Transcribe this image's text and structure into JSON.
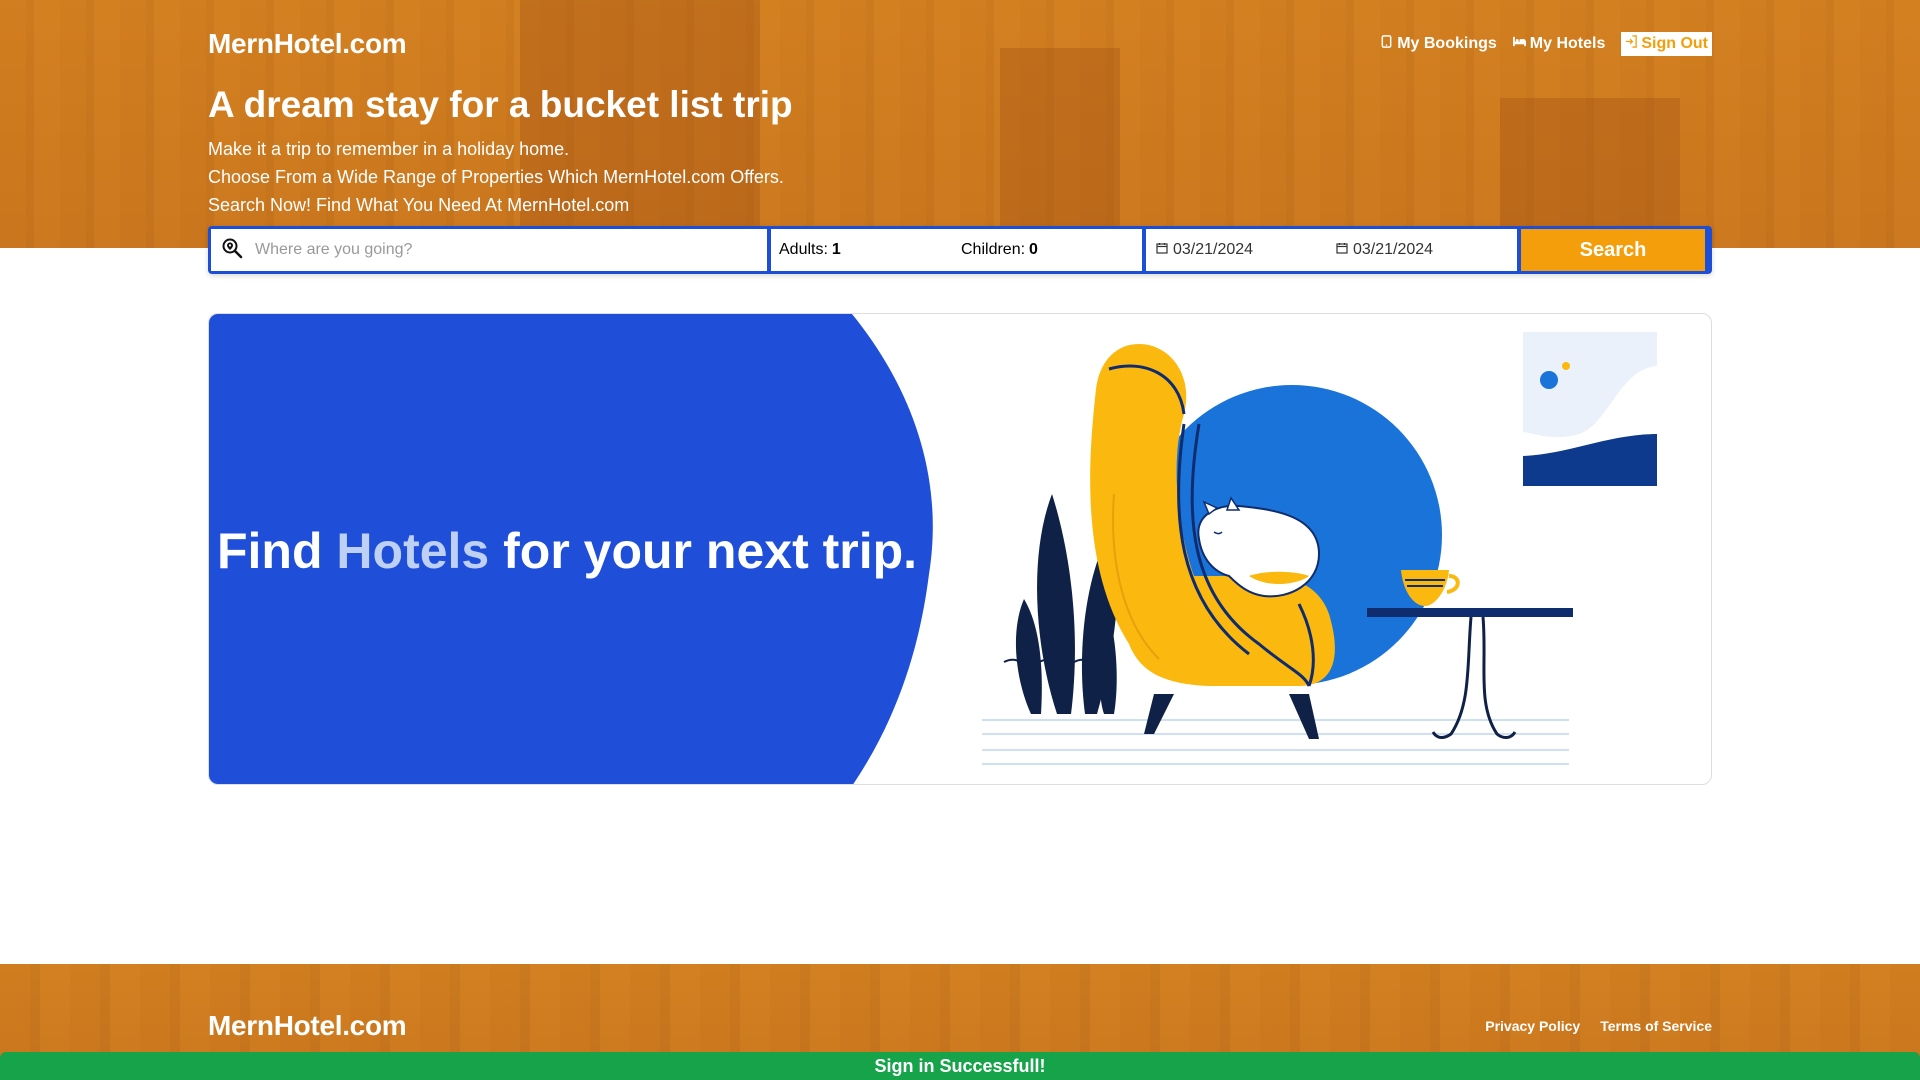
{
  "header": {
    "logo": "MernHotel.com",
    "nav": {
      "my_bookings": "My Bookings",
      "my_hotels": "My Hotels",
      "sign_out": "Sign Out"
    }
  },
  "hero": {
    "title": "A dream stay for a bucket list trip",
    "lines": [
      "Make it a trip to remember in a holiday home.",
      "Choose From a Wide Range of Properties Which MernHotel.com Offers.",
      "Search Now! Find What You Need At MernHotel.com"
    ]
  },
  "search": {
    "destination_placeholder": "Where are you going?",
    "adults_label": "Adults:",
    "adults_value": "1",
    "children_label": "Children:",
    "children_value": "0",
    "check_in": "03/21/2024",
    "check_out": "03/21/2024",
    "button": "Search"
  },
  "banner": {
    "text_before": "Find ",
    "highlight": "Hotels",
    "text_after": " for your next trip."
  },
  "footer": {
    "logo": "MernHotel.com",
    "links": [
      "Privacy Policy",
      "Terms of Service"
    ]
  },
  "toast": {
    "message": "Sign in Successfull!"
  },
  "colors": {
    "brand_orange": "#f59e0b",
    "brand_blue": "#1d4ed8",
    "toast_green": "#16a34a"
  }
}
